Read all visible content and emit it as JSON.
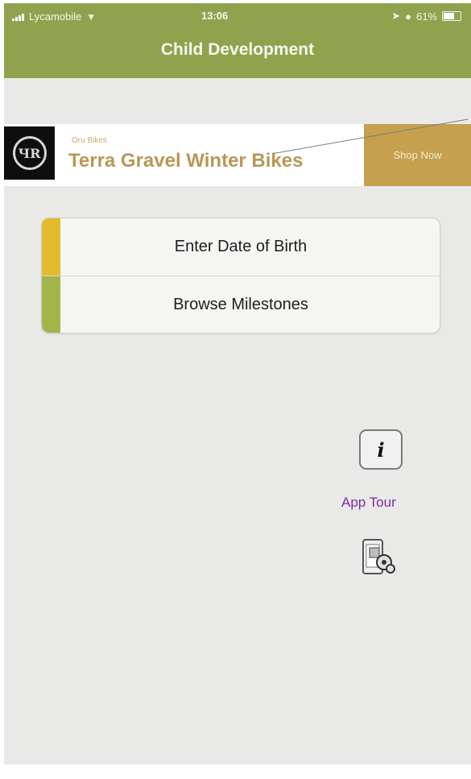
{
  "status_bar": {
    "carrier": "Lycamobile",
    "time": "13:06",
    "battery": "61%"
  },
  "header": {
    "title": "Child Development"
  },
  "ad": {
    "logo_letters": "ЧR",
    "advertiser": "Oru Bikes",
    "headline": "Terra Gravel Winter Bikes",
    "cta": "Shop Now"
  },
  "menu": {
    "items": [
      {
        "label": "Enter Date of Birth",
        "accent": "#e2bb2e"
      },
      {
        "label": "Browse Milestones",
        "accent": "#a3b548"
      }
    ]
  },
  "info": {
    "icon_glyph": "i",
    "tour_label": "App Tour"
  },
  "icons": {
    "info": "info-icon",
    "settings": "device-settings-icon"
  },
  "colors": {
    "header": "#8fa34f",
    "tour_text": "#7b2fa3",
    "ad_cta": "#c4a04f"
  }
}
